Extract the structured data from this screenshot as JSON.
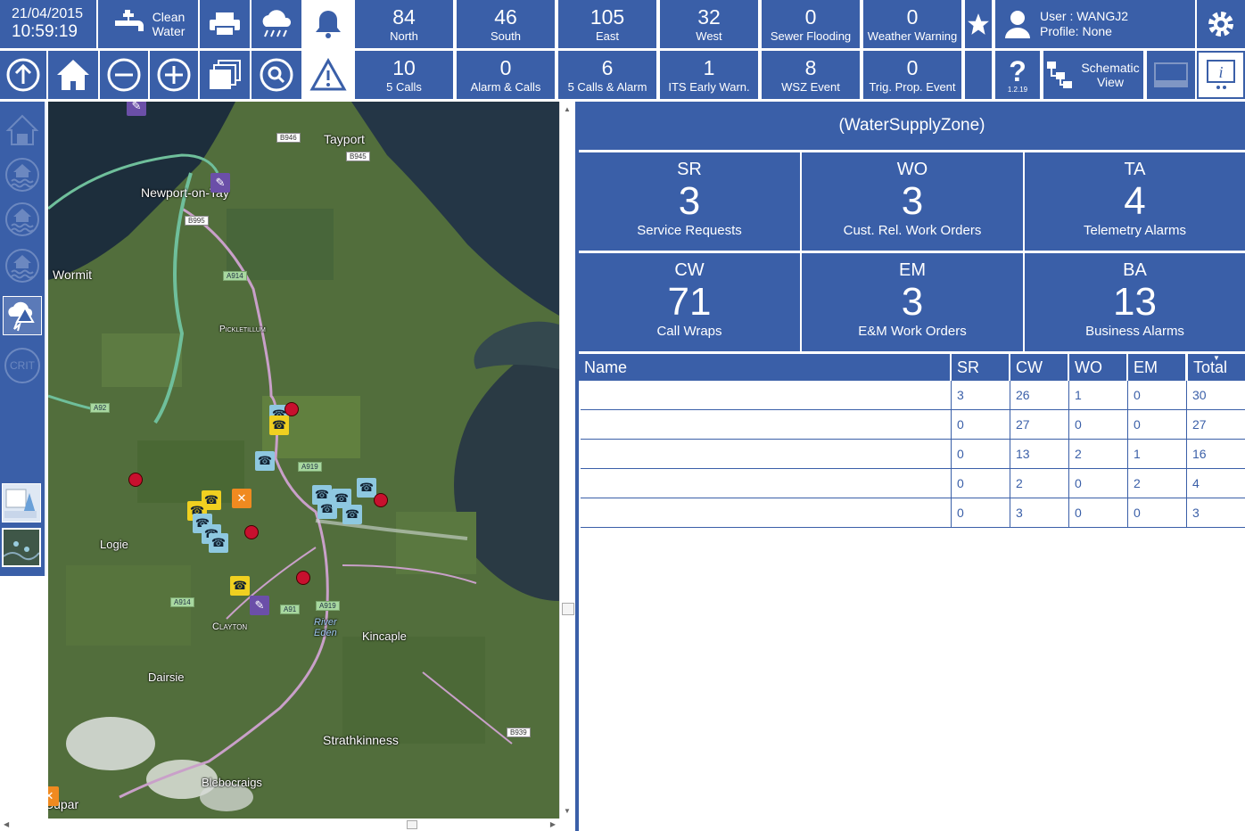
{
  "header": {
    "date": "21/04/2015",
    "time": "10:59:19",
    "service": "Clean\nWater",
    "user_line": "User : WANGJ2",
    "profile_line": "Profile: None"
  },
  "top_row": [
    {
      "value": "84",
      "label": "North"
    },
    {
      "value": "46",
      "label": "South"
    },
    {
      "value": "105",
      "label": "East"
    },
    {
      "value": "32",
      "label": "West"
    },
    {
      "value": "0",
      "label": "Sewer Flooding"
    },
    {
      "value": "0",
      "label": "Weather Warning"
    }
  ],
  "bottom_row": [
    {
      "value": "10",
      "label": "5 Calls"
    },
    {
      "value": "0",
      "label": "Alarm & Calls"
    },
    {
      "value": "6",
      "label": "5 Calls & Alarm"
    },
    {
      "value": "1",
      "label": "ITS Early Warn."
    },
    {
      "value": "8",
      "label": "WSZ Event"
    },
    {
      "value": "0",
      "label": "Trig. Prop. Event"
    }
  ],
  "version": "1.2.19",
  "schematic_label": "Schematic View",
  "sidebar": {
    "crit_label": "CRIT"
  },
  "map": {
    "labels": [
      "Tayport",
      "Newport-on-Tay",
      "Wormit",
      "Pickletillum",
      "Logie",
      "Clayton",
      "Kincaple",
      "Dairsie",
      "Strathkinness",
      "Blebocraigs",
      "Cupar",
      "River Eden"
    ],
    "roads": [
      "B946",
      "B945",
      "B995",
      "A914",
      "A92",
      "A919",
      "A914",
      "A91",
      "A919",
      "B939"
    ]
  },
  "panel": {
    "title": "(WaterSupplyZone)",
    "cells": [
      {
        "code": "SR",
        "value": "3",
        "label": "Service Requests"
      },
      {
        "code": "WO",
        "value": "3",
        "label": "Cust. Rel. Work Orders"
      },
      {
        "code": "TA",
        "value": "4",
        "label": "Telemetry Alarms"
      },
      {
        "code": "CW",
        "value": "71",
        "label": "Call Wraps"
      },
      {
        "code": "EM",
        "value": "3",
        "label": "E&M Work Orders"
      },
      {
        "code": "BA",
        "value": "13",
        "label": "Business Alarms"
      }
    ]
  },
  "table": {
    "headers": [
      "Name",
      "SR",
      "CW",
      "WO",
      "EM",
      "Total"
    ],
    "rows": [
      [
        "",
        "3",
        "26",
        "1",
        "0",
        "30"
      ],
      [
        "",
        "0",
        "27",
        "0",
        "0",
        "27"
      ],
      [
        "",
        "0",
        "13",
        "2",
        "1",
        "16"
      ],
      [
        "",
        "0",
        "2",
        "0",
        "2",
        "4"
      ],
      [
        "",
        "0",
        "3",
        "0",
        "0",
        "3"
      ]
    ]
  }
}
